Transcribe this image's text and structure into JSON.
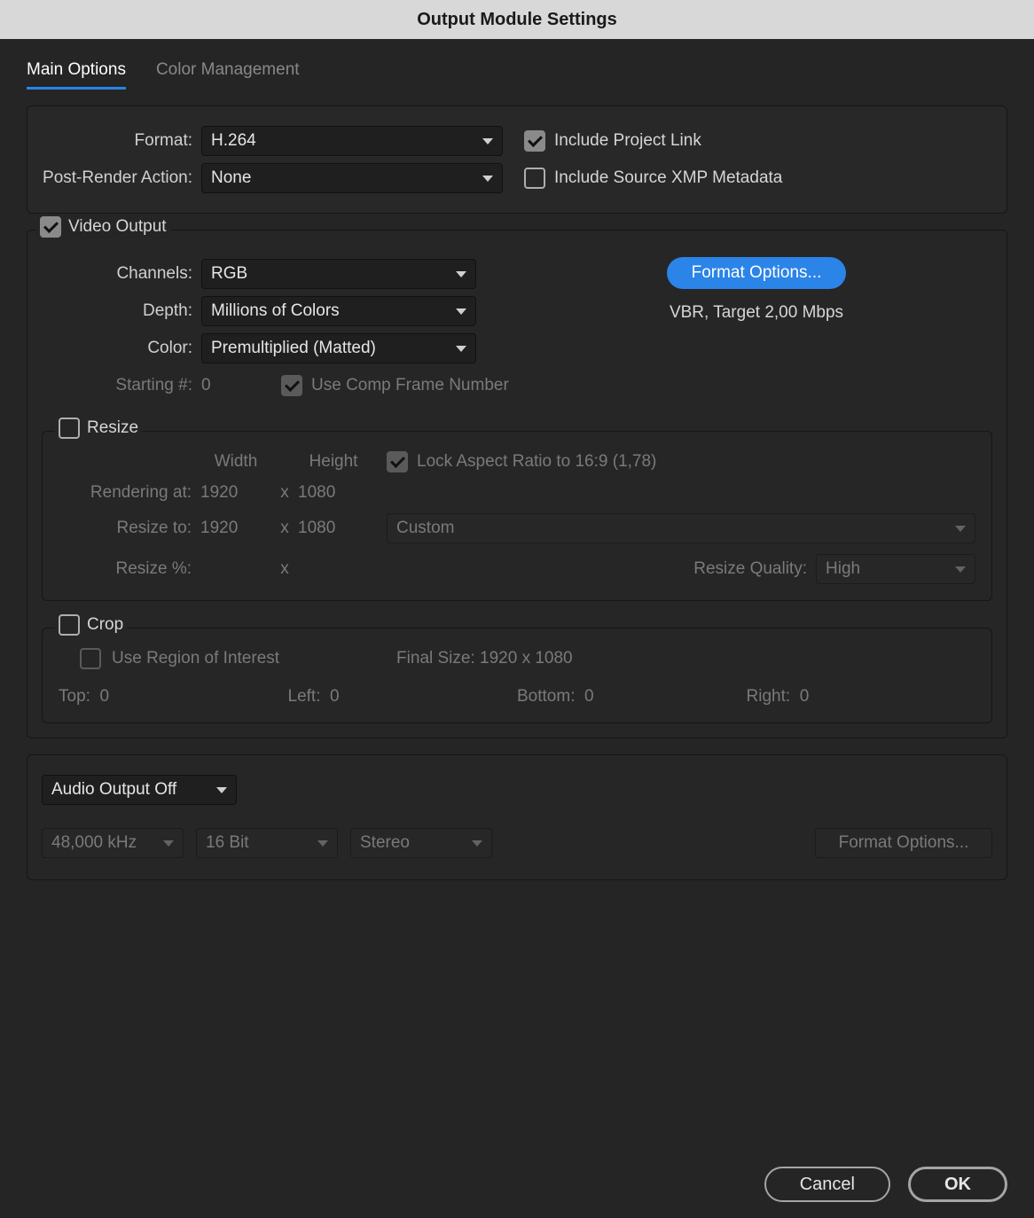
{
  "title": "Output Module Settings",
  "tabs": {
    "main": "Main Options",
    "color": "Color Management"
  },
  "format_panel": {
    "format_label": "Format:",
    "format_value": "H.264",
    "post_render_label": "Post-Render Action:",
    "post_render_value": "None",
    "include_project_link": "Include Project Link",
    "include_xmp": "Include Source XMP Metadata"
  },
  "video": {
    "legend": "Video Output",
    "channels_label": "Channels:",
    "channels_value": "RGB",
    "depth_label": "Depth:",
    "depth_value": "Millions of Colors",
    "color_label": "Color:",
    "color_value": "Premultiplied (Matted)",
    "starting_label": "Starting #:",
    "starting_value": "0",
    "use_comp_frame": "Use Comp Frame Number",
    "format_options_btn": "Format Options...",
    "bitrate_info": "VBR, Target 2,00 Mbps"
  },
  "resize": {
    "legend": "Resize",
    "width_header": "Width",
    "height_header": "Height",
    "lock_aspect": "Lock Aspect Ratio to 16:9 (1,78)",
    "rendering_at_label": "Rendering at:",
    "rendering_at_w": "1920",
    "rendering_at_h": "1080",
    "resize_to_label": "Resize to:",
    "resize_to_w": "1920",
    "resize_to_h": "1080",
    "custom": "Custom",
    "resize_pct_label": "Resize %:",
    "resize_quality_label": "Resize Quality:",
    "resize_quality_value": "High",
    "x": "x"
  },
  "crop": {
    "legend": "Crop",
    "use_roi": "Use Region of Interest",
    "final_size": "Final Size: 1920 x 1080",
    "top_label": "Top:",
    "top_val": "0",
    "left_label": "Left:",
    "left_val": "0",
    "bottom_label": "Bottom:",
    "bottom_val": "0",
    "right_label": "Right:",
    "right_val": "0"
  },
  "audio": {
    "mode": "Audio Output Off",
    "sample_rate": "48,000 kHz",
    "bit_depth": "16 Bit",
    "channels": "Stereo",
    "format_options_btn": "Format Options..."
  },
  "footer": {
    "cancel": "Cancel",
    "ok": "OK"
  }
}
